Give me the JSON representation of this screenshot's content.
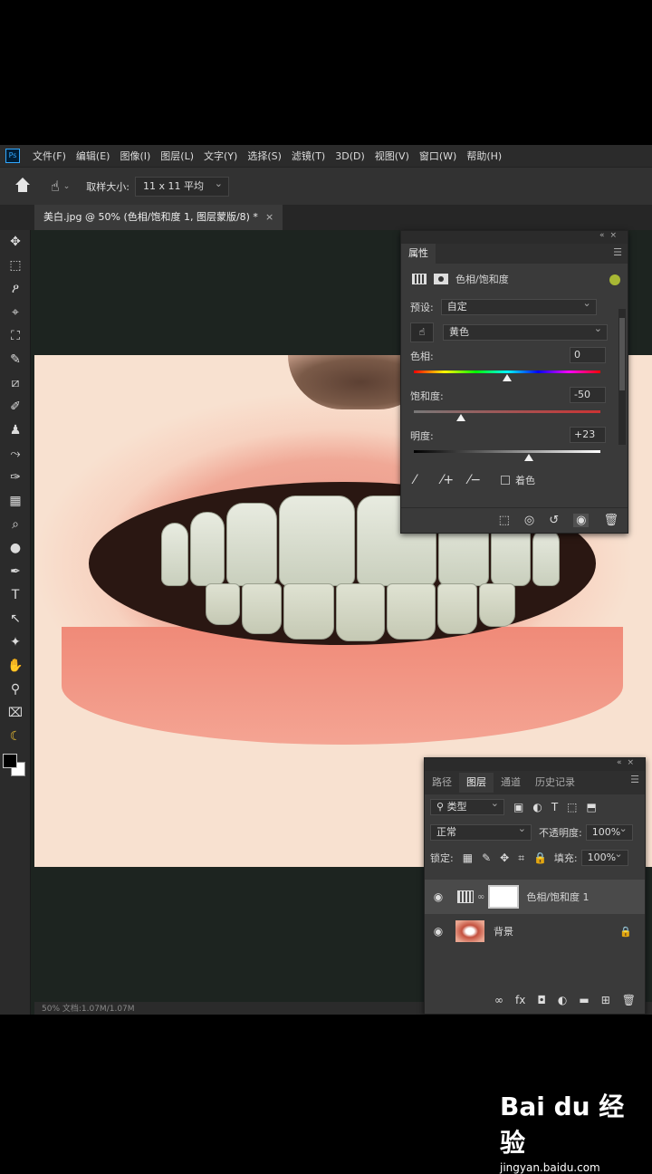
{
  "menubar": {
    "logo": "Ps",
    "items": [
      "文件(F)",
      "编辑(E)",
      "图像(I)",
      "图层(L)",
      "文字(Y)",
      "选择(S)",
      "滤镜(T)",
      "3D(D)",
      "视图(V)",
      "窗口(W)",
      "帮助(H)"
    ]
  },
  "options": {
    "sample_label": "取样大小:",
    "sample_value": "11 x 11 平均"
  },
  "document": {
    "tab_title": "美白.jpg @ 50% (色相/饱和度 1, 图层蒙版/8) *",
    "close": "×",
    "status": "50%      文档:1.07M/1.07M"
  },
  "tools": [
    "✥",
    "⬚",
    "ዖ",
    "⌖",
    "⛶",
    "✎",
    "⧄",
    "✐",
    "♟",
    "⤳",
    "✑",
    "▦",
    "⌕",
    "●",
    "✒",
    "T",
    "↖",
    "✦",
    "✋",
    "⚲",
    "⌧",
    "☾"
  ],
  "properties": {
    "tab": "属性",
    "adjustment": "色相/饱和度",
    "preset_label": "预设:",
    "preset_value": "自定",
    "channel_value": "黄色",
    "hue_label": "色相:",
    "hue_value": "0",
    "saturation_label": "饱和度:",
    "saturation_value": "-50",
    "lightness_label": "明度:",
    "lightness_value": "+23",
    "colorize_label": "着色",
    "hue_position": 0.5,
    "saturation_position": 0.25,
    "lightness_position": 0.615
  },
  "layers_panel": {
    "tabs": [
      "路径",
      "图层",
      "通道",
      "历史记录"
    ],
    "active_tab": "图层",
    "kind_label": "类型",
    "blend_mode": "正常",
    "opacity_label": "不透明度:",
    "opacity_value": "100%",
    "lock_label": "锁定:",
    "fill_label": "填充:",
    "fill_value": "100%",
    "layers": [
      {
        "name": "色相/饱和度 1",
        "type": "adjustment",
        "selected": true
      },
      {
        "name": "背景",
        "type": "image",
        "locked": true
      }
    ]
  },
  "watermark": {
    "logo": "Bai du 经验",
    "url": "jingyan.baidu.com"
  }
}
